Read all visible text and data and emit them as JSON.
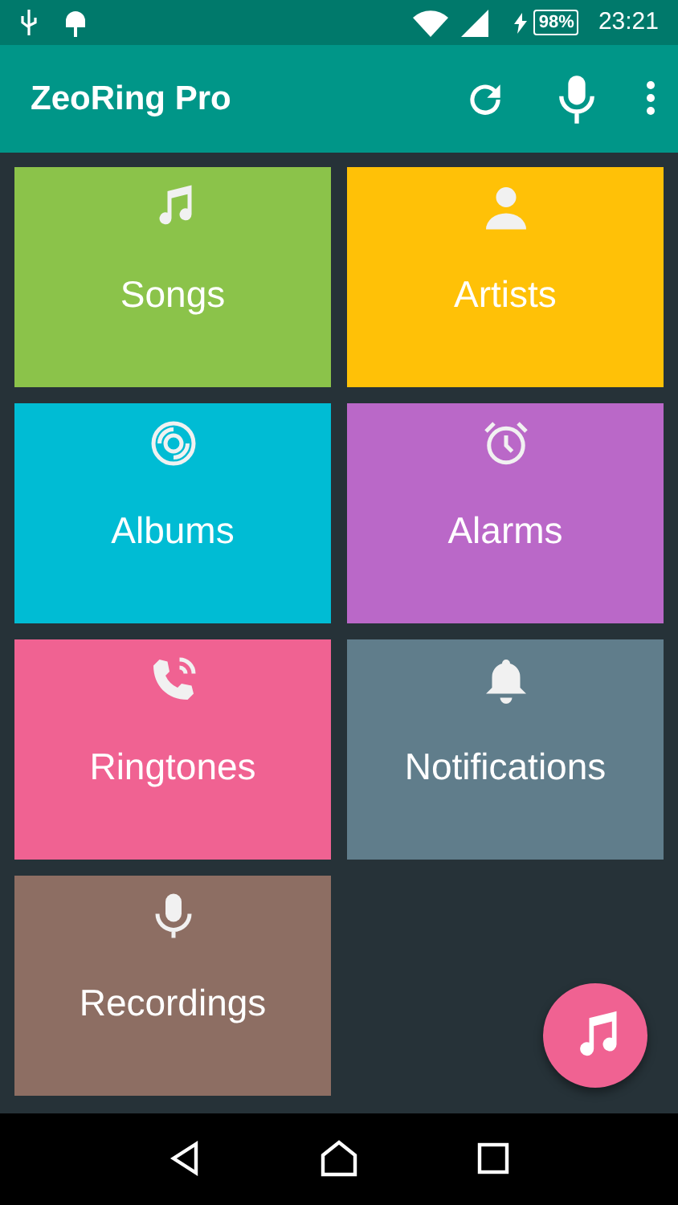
{
  "status_bar": {
    "battery": "98%",
    "time": "23:21"
  },
  "app_bar": {
    "title": "ZeoRing Pro"
  },
  "tiles": [
    {
      "label": "Songs",
      "color": "#8bc34a"
    },
    {
      "label": "Artists",
      "color": "#ffc107"
    },
    {
      "label": "Albums",
      "color": "#00bcd4"
    },
    {
      "label": "Alarms",
      "color": "#ba68c8"
    },
    {
      "label": "Ringtones",
      "color": "#f06292"
    },
    {
      "label": "Notifications",
      "color": "#607d8b"
    },
    {
      "label": "Recordings",
      "color": "#8d6e63"
    }
  ]
}
